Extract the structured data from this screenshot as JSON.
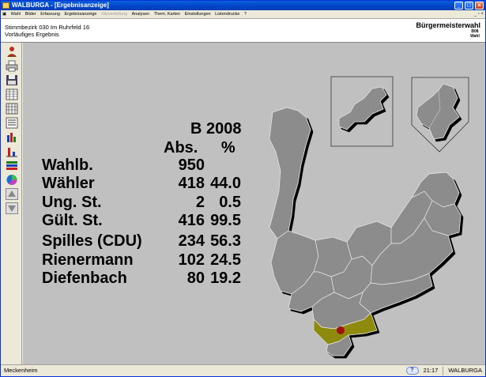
{
  "window": {
    "title": "WALBURGA - [Ergebnisanzeige]"
  },
  "menu": {
    "items": [
      {
        "label": "Wahl",
        "enabled": true
      },
      {
        "label": "Bilder",
        "enabled": true
      },
      {
        "label": "Erfassung",
        "enabled": true
      },
      {
        "label": "Ergebnisanzeige",
        "enabled": true
      },
      {
        "label": "Sitzverteilung",
        "enabled": false
      },
      {
        "label": "Analysen",
        "enabled": true
      },
      {
        "label": "Them. Karten",
        "enabled": true
      },
      {
        "label": "Einstellungen",
        "enabled": true
      },
      {
        "label": "Listendrucke",
        "enabled": true
      },
      {
        "label": "?",
        "enabled": true
      }
    ]
  },
  "header": {
    "district": "Stimmbezirk 030 Im Ruhrfeld 16",
    "status": "Vorläufiges Ergebnis",
    "election": "Bürgermeisterwahl",
    "code_line1": "B08",
    "code_line2": "Wahl"
  },
  "toolbar": {
    "icons": [
      "person-icon",
      "printer-icon",
      "save-icon",
      "table-icon",
      "grid-icon",
      "list-icon",
      "bar-chart-icon",
      "column-chart-icon",
      "layers-icon",
      "pie-chart-icon",
      "arrow-up-icon",
      "arrow-down-icon"
    ]
  },
  "results": {
    "heading_line1": "B 2008",
    "heading_abs": "Abs.",
    "heading_pct": "%",
    "rows": [
      {
        "label": "Wahlb.",
        "abs": "950",
        "pct": ""
      },
      {
        "label": "Wähler",
        "abs": "418",
        "pct": "44.0"
      },
      {
        "label": "Ung. St.",
        "abs": "2",
        "pct": "0.5"
      },
      {
        "label": "Gült. St.",
        "abs": "416",
        "pct": "99.5"
      },
      {
        "label": "Spilles (CDU)",
        "abs": "234",
        "pct": "56.3"
      },
      {
        "label": "Rienermann",
        "abs": "102",
        "pct": "24.5"
      },
      {
        "label": "Diefenbach",
        "abs": "80",
        "pct": "19.2"
      }
    ]
  },
  "map": {
    "district_color": "#8c8c8c",
    "highlight_color": "#8e8a10",
    "marker_color": "#a01010"
  },
  "statusbar": {
    "place": "Meckenheim",
    "help": "?",
    "time": "21:17",
    "app": "WALBURGA"
  }
}
